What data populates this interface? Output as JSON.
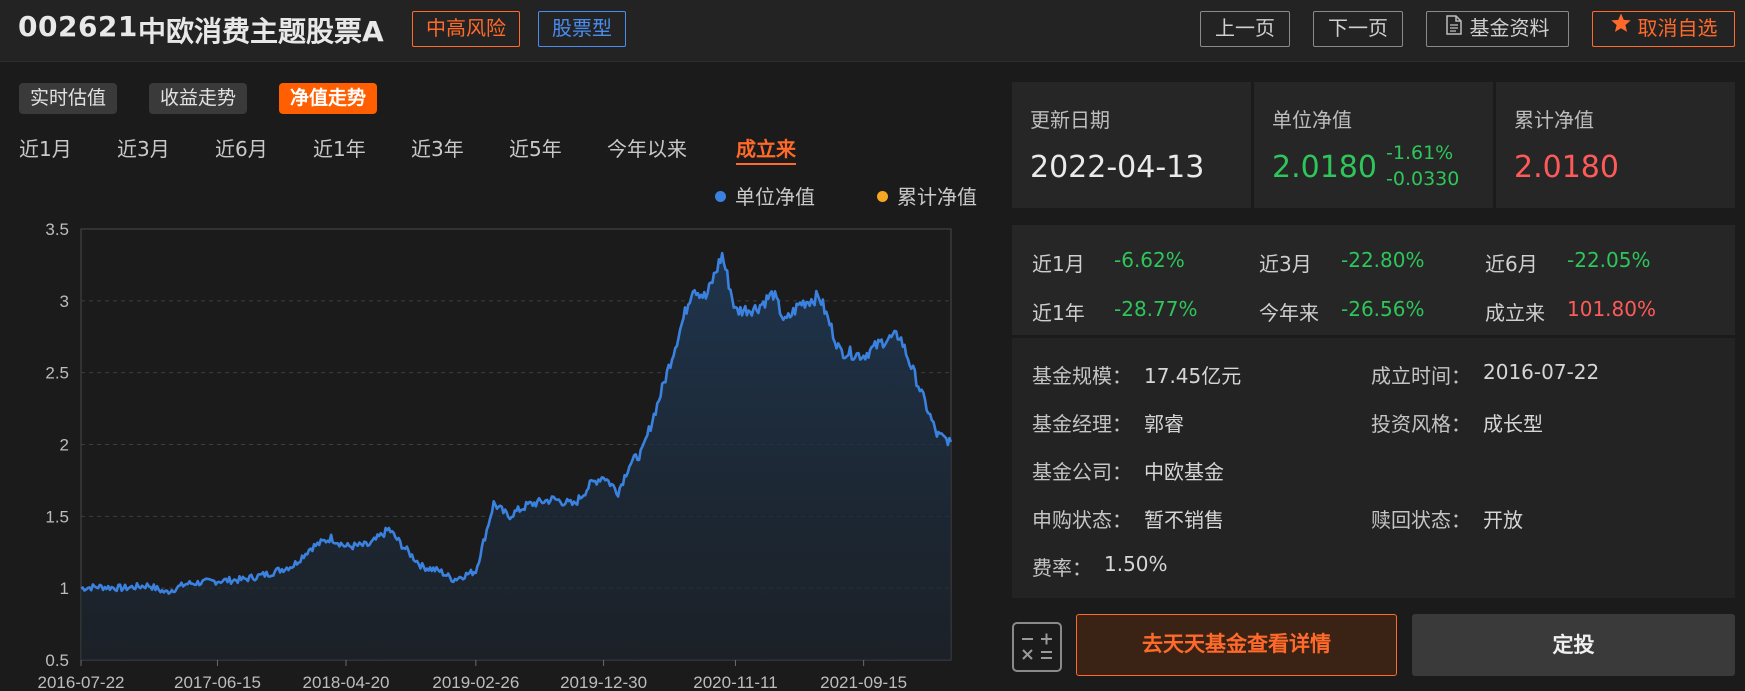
{
  "header": {
    "fund_code": "002621",
    "fund_name": "中欧消费主题股票A",
    "risk_tag": "中高风险",
    "type_tag": "股票型",
    "prev_label": "上一页",
    "next_label": "下一页",
    "info_label": "基金资料",
    "unfavorite_label": "取消自选"
  },
  "chart_modes": [
    {
      "label": "实时估值",
      "active": false
    },
    {
      "label": "收益走势",
      "active": false
    },
    {
      "label": "净值走势",
      "active": true
    }
  ],
  "periods": [
    {
      "label": "近1月",
      "active": false
    },
    {
      "label": "近3月",
      "active": false
    },
    {
      "label": "近6月",
      "active": false
    },
    {
      "label": "近1年",
      "active": false
    },
    {
      "label": "近3年",
      "active": false
    },
    {
      "label": "近5年",
      "active": false
    },
    {
      "label": "今年以来",
      "active": false
    },
    {
      "label": "成立来",
      "active": true
    }
  ],
  "legend": [
    {
      "name": "单位净值",
      "color": "#3b82e0"
    },
    {
      "name": "累计净值",
      "color": "#f5a623"
    }
  ],
  "nav": {
    "update_date_label": "更新日期",
    "update_date": "2022-04-13",
    "unit_nav_label": "单位净值",
    "unit_nav": "2.0180",
    "change_pct": "-1.61%",
    "change_abs": "-0.0330",
    "acc_nav_label": "累计净值",
    "acc_nav": "2.0180"
  },
  "returns": [
    {
      "label": "近1月",
      "value": "-6.62%",
      "sign": "neg"
    },
    {
      "label": "近3月",
      "value": "-22.80%",
      "sign": "neg"
    },
    {
      "label": "近6月",
      "value": "-22.05%",
      "sign": "neg"
    },
    {
      "label": "近1年",
      "value": "-28.77%",
      "sign": "neg"
    },
    {
      "label": "今年来",
      "value": "-26.56%",
      "sign": "neg"
    },
    {
      "label": "成立来",
      "value": "101.80%",
      "sign": "pos"
    }
  ],
  "details": {
    "scale_label": "基金规模：",
    "scale": "17.45亿元",
    "established_label": "成立时间：",
    "established": "2016-07-22",
    "manager_label": "基金经理：",
    "manager": "郭睿",
    "style_label": "投资风格：",
    "style": "成长型",
    "company_label": "基金公司：",
    "company": "中欧基金",
    "purchase_label": "申购状态：",
    "purchase": "暂不销售",
    "redeem_label": "赎回状态：",
    "redeem": "开放",
    "fee_label": "费率：",
    "fee": "1.50%"
  },
  "actions": {
    "detail_label": "去天天基金查看详情",
    "invest_label": "定投"
  },
  "colors": {
    "accent": "#ff6a2a",
    "line": "#3b82e0",
    "negative": "#2ec55a",
    "positive": "#ff5a5a"
  },
  "chart_data": {
    "type": "area",
    "series": [
      {
        "name": "单位净值",
        "points": [
          [
            "2016-07-22",
            1.0
          ],
          [
            "2016-09-01",
            1.01
          ],
          [
            "2016-11-01",
            1.0
          ],
          [
            "2017-01-01",
            1.02
          ],
          [
            "2017-02-10",
            0.97
          ],
          [
            "2017-04-01",
            1.03
          ],
          [
            "2017-06-15",
            1.05
          ],
          [
            "2017-08-15",
            1.06
          ],
          [
            "2017-10-15",
            1.1
          ],
          [
            "2017-12-15",
            1.16
          ],
          [
            "2018-01-25",
            1.28
          ],
          [
            "2018-03-15",
            1.35
          ],
          [
            "2018-04-20",
            1.29
          ],
          [
            "2018-06-15",
            1.3
          ],
          [
            "2018-08-01",
            1.41
          ],
          [
            "2018-09-01",
            1.3
          ],
          [
            "2018-10-20",
            1.15
          ],
          [
            "2018-12-01",
            1.12
          ],
          [
            "2019-01-03",
            1.06
          ],
          [
            "2019-02-26",
            1.12
          ],
          [
            "2019-03-20",
            1.36
          ],
          [
            "2019-04-10",
            1.59
          ],
          [
            "2019-05-15",
            1.5
          ],
          [
            "2019-07-01",
            1.58
          ],
          [
            "2019-09-01",
            1.62
          ],
          [
            "2019-10-20",
            1.58
          ],
          [
            "2019-12-01",
            1.73
          ],
          [
            "2019-12-30",
            1.78
          ],
          [
            "2020-02-03",
            1.67
          ],
          [
            "2020-03-01",
            1.86
          ],
          [
            "2020-04-01",
            1.95
          ],
          [
            "2020-05-15",
            2.35
          ],
          [
            "2020-07-01",
            2.8
          ],
          [
            "2020-08-01",
            3.1
          ],
          [
            "2020-09-01",
            3.02
          ],
          [
            "2020-10-10",
            3.32
          ],
          [
            "2020-11-11",
            2.93
          ],
          [
            "2021-01-01",
            2.95
          ],
          [
            "2021-02-10",
            3.05
          ],
          [
            "2021-03-10",
            2.85
          ],
          [
            "2021-04-15",
            2.98
          ],
          [
            "2021-06-01",
            3.03
          ],
          [
            "2021-07-20",
            2.65
          ],
          [
            "2021-09-15",
            2.62
          ],
          [
            "2021-11-01",
            2.72
          ],
          [
            "2021-12-10",
            2.76
          ],
          [
            "2022-01-20",
            2.45
          ],
          [
            "2022-03-10",
            2.07
          ],
          [
            "2022-04-13",
            2.018
          ]
        ]
      }
    ],
    "x_ticks": [
      "2016-07-22",
      "2017-06-15",
      "2018-04-20",
      "2019-02-26",
      "2019-12-30",
      "2020-11-11",
      "2021-09-15"
    ],
    "y_ticks": [
      0.5,
      1,
      1.5,
      2,
      2.5,
      3,
      3.5
    ],
    "xlim": [
      "2016-07-22",
      "2022-04-13"
    ],
    "ylim": [
      0.5,
      3.5
    ],
    "grid": true,
    "legend_position": "top-right"
  }
}
